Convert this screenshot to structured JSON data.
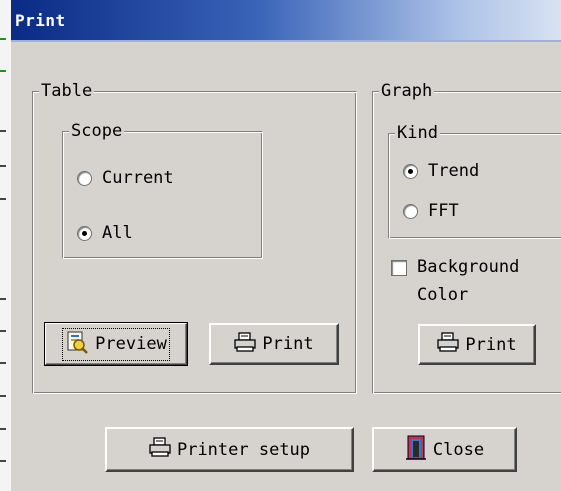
{
  "window": {
    "title": "Print"
  },
  "table_group": {
    "label": "Table",
    "scope": {
      "label": "Scope",
      "options": [
        {
          "label": "Current",
          "selected": false
        },
        {
          "label": "All",
          "selected": true
        }
      ]
    },
    "preview_label": "Preview",
    "print_label": "Print"
  },
  "graph_group": {
    "label": "Graph",
    "kind": {
      "label": "Kind",
      "options": [
        {
          "label": "Trend",
          "selected": true
        },
        {
          "label": "FFT",
          "selected": false
        }
      ]
    },
    "background_color": {
      "line1": "Background",
      "line2": "Color",
      "checked": false
    },
    "print_label": "Print"
  },
  "footer": {
    "printer_setup_label": "Printer setup",
    "close_label": "Close"
  },
  "icons": {
    "preview": "preview-icon",
    "printer": "printer-icon",
    "close": "door-exit-icon"
  }
}
